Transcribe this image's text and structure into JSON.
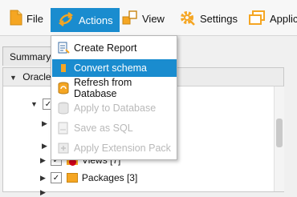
{
  "toolbar": {
    "file_label": "File",
    "actions_label": "Actions",
    "view_label": "View",
    "settings_label": "Settings",
    "applic_label": "Applic"
  },
  "tabs": {
    "summary_label": "Summary"
  },
  "tree": {
    "root_label": "Oracle",
    "views_label": "Views [7]",
    "packages_label": "Packages [3]"
  },
  "menu": {
    "items": [
      {
        "label": "Create Report",
        "icon": "report-icon",
        "enabled": true
      },
      {
        "label": "Convert schema",
        "icon": "convert-icon",
        "enabled": true,
        "highlighted": true
      },
      {
        "label": "Refresh from Database",
        "icon": "refresh-db-icon",
        "enabled": true
      },
      {
        "label": "Apply to Database",
        "icon": "apply-db-icon",
        "enabled": false
      },
      {
        "label": "Save as SQL",
        "icon": "sql-icon",
        "enabled": false
      },
      {
        "label": "Apply Extension Pack",
        "icon": "extension-pack-icon",
        "enabled": false
      }
    ]
  },
  "colors": {
    "accent": "#1a8ccf",
    "icon_orange": "#f5a623"
  }
}
